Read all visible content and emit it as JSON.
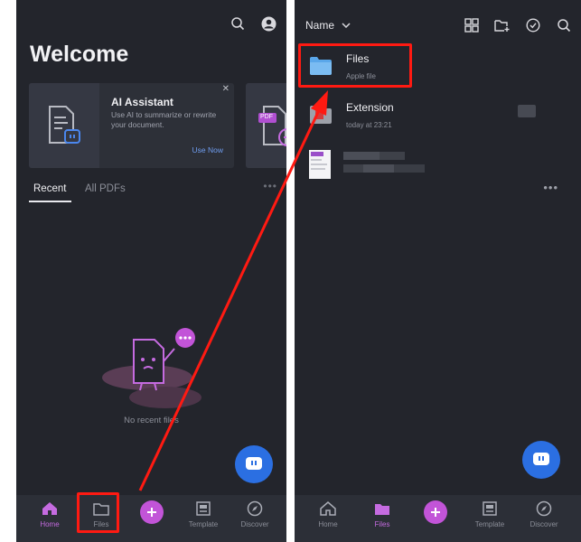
{
  "left": {
    "welcome_title": "Welcome",
    "ai_card": {
      "title": "AI Assistant",
      "description": "Use AI to summarize or rewrite your document.",
      "cta": "Use Now",
      "close": "✕"
    },
    "pdf_card_badge": "PDF",
    "tabs": [
      "Recent",
      "All PDFs"
    ],
    "tabs_more": "•••",
    "empty_text": "No recent files",
    "nav": {
      "home": "Home",
      "files": "Files",
      "template": "Template",
      "discover": "Discover"
    }
  },
  "right": {
    "sort_label": "Name",
    "files": [
      {
        "name": "Files",
        "meta": "Apple file"
      },
      {
        "name": "Extension",
        "meta": "today at 23:21"
      }
    ],
    "row_more": "•••",
    "nav": {
      "home": "Home",
      "files": "Files",
      "template": "Template",
      "discover": "Discover"
    }
  },
  "colors": {
    "panel_bg": "#23252c",
    "accent_purple": "#c254d8",
    "fab_blue": "#2b6fe2",
    "highlight_red": "#ff1a12",
    "folder_blue": "#5aa7ea"
  },
  "icons": [
    "search-icon",
    "account-icon",
    "document-ai-icon",
    "close-icon",
    "home-icon",
    "folder-icon",
    "plus-icon",
    "template-icon",
    "compass-icon",
    "grid-view-icon",
    "new-folder-icon",
    "select-check-icon",
    "chevron-down-icon",
    "chat-bubble-icon"
  ]
}
